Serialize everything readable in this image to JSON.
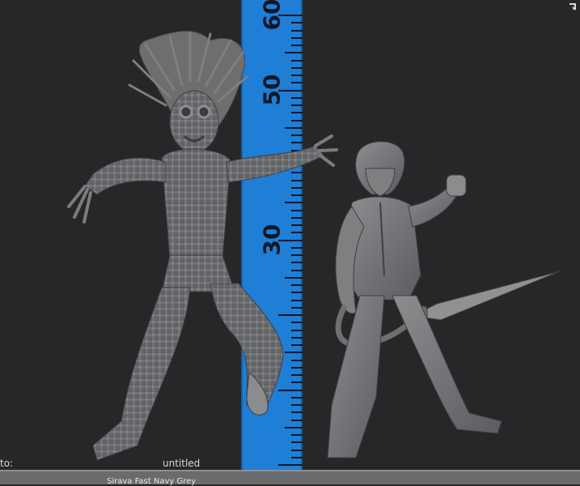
{
  "viewport": {
    "background": "#262728",
    "ruler_color": "#1f7ed6",
    "ruler_labels": [
      "60",
      "50",
      "30"
    ],
    "ruler_label_values": [
      60,
      50,
      30
    ],
    "figures": [
      "monster-sculpt",
      "swordsman-sculpt"
    ],
    "model_color": "#6f7173"
  },
  "status_bar": {
    "left_text": "to:",
    "center_text": "untitled",
    "tab_text": "Sirava Fast Navy Grey"
  },
  "icons": {
    "corner": "rotate-arrow-icon"
  }
}
